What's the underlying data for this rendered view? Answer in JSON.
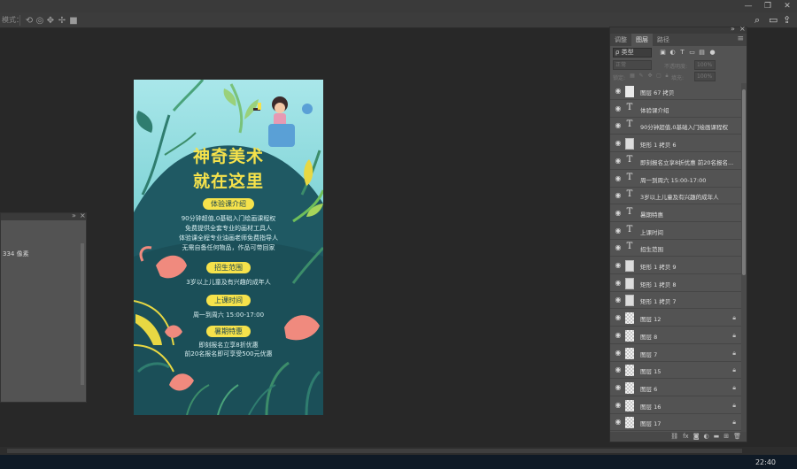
{
  "window": {
    "controls": [
      "—",
      "❐",
      "✕"
    ]
  },
  "options_bar": {
    "mode_label": "模式：",
    "icons": [
      "rotate-3d-icon",
      "roll-3d-icon",
      "drag-3d-icon",
      "slide-3d-icon",
      "scale-3d-icon"
    ],
    "right_icons": [
      "search-icon",
      "workspace-icon",
      "share-icon"
    ]
  },
  "left_panel": {
    "info_text": "334 像素"
  },
  "document": {
    "title_line1": "神奇美术",
    "title_line2": "就在这里",
    "pill_intro": "体验课介绍",
    "intro_lines": [
      "90分钟超值,0基础入门绘画课程权",
      "免费提供全套专业的画材工具人",
      "体验课全程专业油画老师免费指导人",
      "无需自备任何物品，作品可带回家"
    ],
    "pill_range": "招生范围",
    "range_line": "3岁以上儿童及有兴趣的成年人",
    "pill_time": "上课时间",
    "time_line": "周一到周六  15:00-17:00",
    "pill_offer": "暑期特惠",
    "offer_lines": [
      "即刻报名立享8折优惠",
      "前20名报名即可享受500元优惠"
    ]
  },
  "layers_panel": {
    "tabs": [
      "调整",
      "图层",
      "路径"
    ],
    "active_tab": 1,
    "filter_kind": "ρ 类型",
    "blend_mode": "正常",
    "opacity_label": "不透明度:",
    "opacity_value": "100%",
    "lock_label": "锁定:",
    "fill_label": "填充:",
    "fill_value": "100%",
    "layers": [
      {
        "name": "图层 67 拷贝",
        "kind": "pixel",
        "locked": false
      },
      {
        "name": "体验课介绍",
        "kind": "text",
        "locked": false
      },
      {
        "name": "90分钟超值,0基础入门绘画课程权",
        "kind": "text",
        "locked": false
      },
      {
        "name": "矩形 1 拷贝 6",
        "kind": "shape",
        "locked": false
      },
      {
        "name": "即刻报名立享8折优惠  前20名报名...",
        "kind": "text",
        "locked": false
      },
      {
        "name": "周一到周六  15:00-17:00",
        "kind": "text",
        "locked": false
      },
      {
        "name": "3岁以上儿童及有兴趣的成年人",
        "kind": "text",
        "locked": false
      },
      {
        "name": "暑期特惠",
        "kind": "text",
        "locked": false
      },
      {
        "name": "上课时间",
        "kind": "text",
        "locked": false
      },
      {
        "name": "招生范围",
        "kind": "text",
        "locked": false
      },
      {
        "name": "矩形 1 拷贝 9",
        "kind": "shape",
        "locked": false
      },
      {
        "name": "矩形 1 拷贝 8",
        "kind": "shape",
        "locked": false
      },
      {
        "name": "矩形 1 拷贝 7",
        "kind": "shape",
        "locked": false
      },
      {
        "name": "图层 12",
        "kind": "checker",
        "locked": true
      },
      {
        "name": "图层 8",
        "kind": "checker",
        "locked": true
      },
      {
        "name": "图层 7",
        "kind": "checker",
        "locked": true
      },
      {
        "name": "图层 15",
        "kind": "checker",
        "locked": true
      },
      {
        "name": "图层 6",
        "kind": "checker",
        "locked": true
      },
      {
        "name": "图层 16",
        "kind": "checker",
        "locked": true
      },
      {
        "name": "图层 17",
        "kind": "checker",
        "locked": true
      }
    ],
    "bottom_icons": [
      "link-icon",
      "fx-icon",
      "mask-icon",
      "adjustment-icon",
      "group-icon",
      "new-layer-icon",
      "trash-icon"
    ]
  },
  "taskbar": {
    "clock": "22:40"
  },
  "colors": {
    "accent_yellow": "#f6e24b",
    "poster_teal": "#1f5963",
    "ui_panel": "#535353"
  }
}
